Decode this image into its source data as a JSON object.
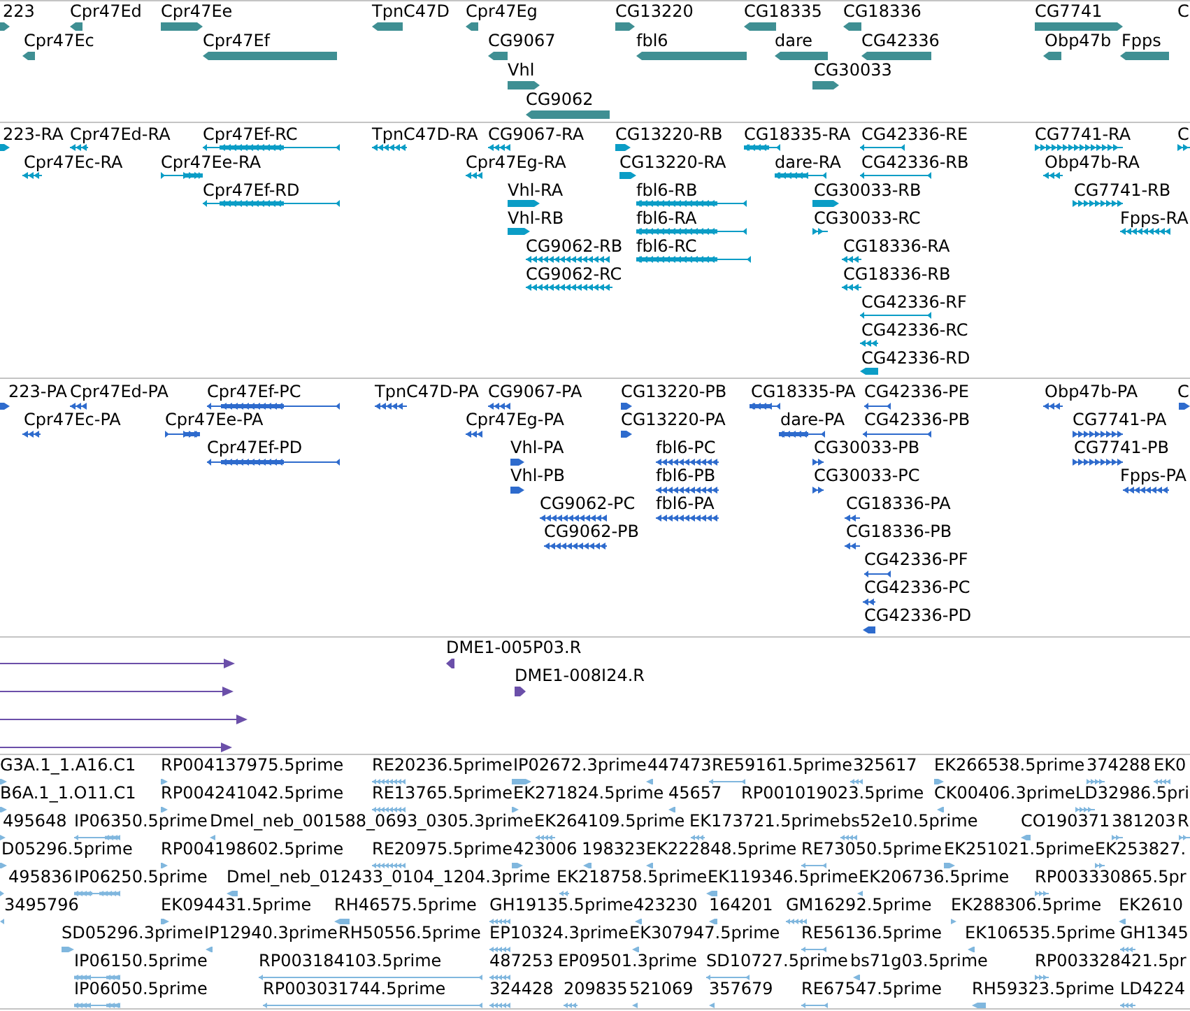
{
  "tracks": [
    {
      "kind": "gene",
      "lanes": [
        {
          "features": [
            {
              "label": "223",
              "reverse": false
            },
            {
              "label": "Cpr47Ed",
              "reverse": true
            },
            {
              "label": "Cpr47Ee",
              "reverse": false
            },
            {
              "label": "TpnC47D",
              "reverse": true
            },
            {
              "label": "Cpr47Eg",
              "reverse": true
            },
            {
              "label": "CG13220",
              "reverse": false
            },
            {
              "label": "CG18335",
              "reverse": true
            },
            {
              "label": "CG18336",
              "reverse": true
            },
            {
              "label": "CG7741",
              "reverse": false
            },
            {
              "label": "C"
            }
          ]
        },
        {
          "features": [
            {
              "label": "Cpr47Ec",
              "reverse": true
            },
            {
              "label": "Cpr47Ef",
              "reverse": true
            },
            {
              "label": "CG9067",
              "reverse": true
            },
            {
              "label": "fbl6",
              "reverse": true
            },
            {
              "label": "dare",
              "reverse": true
            },
            {
              "label": "CG42336",
              "reverse": true
            },
            {
              "label": "Obp47b",
              "reverse": true
            },
            {
              "label": "Fpps",
              "reverse": true
            }
          ]
        },
        {
          "features": [
            {
              "label": "Vhl",
              "reverse": false
            },
            {
              "label": "CG30033",
              "reverse": false
            }
          ]
        },
        {
          "features": [
            {
              "label": "CG9062",
              "reverse": true
            }
          ]
        }
      ]
    },
    {
      "kind": "transcript",
      "lanes": [
        {
          "features": [
            {
              "label": "223-RA",
              "reverse": false
            },
            {
              "label": "Cpr47Ed-RA",
              "reverse": true
            },
            {
              "label": "Cpr47Ef-RC",
              "reverse": true
            },
            {
              "label": "TpnC47D-RA",
              "reverse": true
            },
            {
              "label": "CG9067-RA",
              "reverse": true
            },
            {
              "label": "CG13220-RB",
              "reverse": false
            },
            {
              "label": "CG18335-RA",
              "reverse": true
            },
            {
              "label": "CG42336-RE",
              "reverse": true
            },
            {
              "label": "CG7741-RA",
              "reverse": false
            },
            {
              "label": "C",
              "reverse": false
            }
          ]
        },
        {
          "features": [
            {
              "label": "Cpr47Ec-RA",
              "reverse": true
            },
            {
              "label": "Cpr47Ee-RA",
              "reverse": false
            },
            {
              "label": "Cpr47Eg-RA",
              "reverse": true
            },
            {
              "label": "CG13220-RA",
              "reverse": false
            },
            {
              "label": "dare-RA",
              "reverse": true
            },
            {
              "label": "CG42336-RB",
              "reverse": true
            },
            {
              "label": "Obp47b-RA",
              "reverse": true
            }
          ]
        },
        {
          "features": [
            {
              "label": "Cpr47Ef-RD",
              "reverse": true
            },
            {
              "label": "Vhl-RA",
              "reverse": false
            },
            {
              "label": "fbl6-RB",
              "reverse": true
            },
            {
              "label": "CG30033-RB",
              "reverse": false
            },
            {
              "label": "CG7741-RB",
              "reverse": false
            }
          ]
        },
        {
          "features": [
            {
              "label": "Vhl-RB",
              "reverse": false
            },
            {
              "label": "fbl6-RA",
              "reverse": true
            },
            {
              "label": "CG30033-RC",
              "reverse": false
            },
            {
              "label": "Fpps-RA",
              "reverse": true
            }
          ]
        },
        {
          "features": [
            {
              "label": "CG9062-RB",
              "reverse": true
            },
            {
              "label": "fbl6-RC",
              "reverse": true
            },
            {
              "label": "CG18336-RA",
              "reverse": true
            }
          ]
        },
        {
          "features": [
            {
              "label": "CG9062-RC",
              "reverse": true
            },
            {
              "label": "CG18336-RB",
              "reverse": true
            }
          ]
        },
        {
          "features": [
            {
              "label": "CG42336-RF",
              "reverse": true
            }
          ]
        },
        {
          "features": [
            {
              "label": "CG42336-RC",
              "reverse": true
            }
          ]
        },
        {
          "features": [
            {
              "label": "CG42336-RD",
              "reverse": true
            }
          ]
        }
      ]
    },
    {
      "kind": "protein",
      "lanes": [
        {
          "features": [
            {
              "label": "223-PA",
              "reverse": false
            },
            {
              "label": "Cpr47Ed-PA",
              "reverse": true
            },
            {
              "label": "Cpr47Ef-PC",
              "reverse": true
            },
            {
              "label": "TpnC47D-PA",
              "reverse": true
            },
            {
              "label": "CG9067-PA",
              "reverse": true
            },
            {
              "label": "CG13220-PB",
              "reverse": false
            },
            {
              "label": "CG18335-PA",
              "reverse": true
            },
            {
              "label": "CG42336-PE",
              "reverse": true
            },
            {
              "label": "Obp47b-PA",
              "reverse": true
            },
            {
              "label": "C",
              "reverse": false
            }
          ]
        },
        {
          "features": [
            {
              "label": "Cpr47Ec-PA",
              "reverse": true
            },
            {
              "label": "Cpr47Ee-PA",
              "reverse": false
            },
            {
              "label": "Cpr47Eg-PA",
              "reverse": true
            },
            {
              "label": "CG13220-PA",
              "reverse": false
            },
            {
              "label": "dare-PA",
              "reverse": true
            },
            {
              "label": "CG42336-PB",
              "reverse": true
            },
            {
              "label": "CG7741-PA",
              "reverse": false
            }
          ]
        },
        {
          "features": [
            {
              "label": "Cpr47Ef-PD",
              "reverse": true
            },
            {
              "label": "Vhl-PA",
              "reverse": false
            },
            {
              "label": "fbl6-PC",
              "reverse": true
            },
            {
              "label": "CG30033-PB",
              "reverse": false
            },
            {
              "label": "CG7741-PB",
              "reverse": false
            }
          ]
        },
        {
          "features": [
            {
              "label": "Vhl-PB",
              "reverse": false
            },
            {
              "label": "fbl6-PB",
              "reverse": true
            },
            {
              "label": "CG30033-PC",
              "reverse": false
            },
            {
              "label": "Fpps-PA",
              "reverse": true
            }
          ]
        },
        {
          "features": [
            {
              "label": "CG9062-PC",
              "reverse": true
            },
            {
              "label": "fbl6-PA",
              "reverse": true
            },
            {
              "label": "CG18336-PA",
              "reverse": true
            }
          ]
        },
        {
          "features": [
            {
              "label": "CG9062-PB",
              "reverse": true
            },
            {
              "label": "CG18336-PB",
              "reverse": true
            }
          ]
        },
        {
          "features": [
            {
              "label": "CG42336-PF",
              "reverse": true
            }
          ]
        },
        {
          "features": [
            {
              "label": "CG42336-PC",
              "reverse": true
            }
          ]
        },
        {
          "features": [
            {
              "label": "CG42336-PD",
              "reverse": true
            }
          ]
        }
      ]
    },
    {
      "kind": "clone",
      "lanes": [
        {
          "features": [
            {
              "reverse": false
            },
            {
              "label": "DME1-005P03.R",
              "reverse": true
            }
          ]
        },
        {
          "features": [
            {
              "reverse": false
            },
            {
              "label": "DME1-008I24.R",
              "reverse": false
            }
          ]
        },
        {
          "features": [
            {
              "reverse": false
            }
          ]
        },
        {
          "features": [
            {
              "reverse": false
            }
          ]
        }
      ]
    },
    {
      "kind": "est",
      "lanes": [
        {
          "features": [
            {
              "label": "G3A.1_1.A16.C1",
              "reverse": false
            },
            {
              "label": "RP004137975.5prime",
              "reverse": false
            },
            {
              "label": "RE20236.5prime",
              "reverse": true
            },
            {
              "label": "IP02672.3prime",
              "reverse": false
            },
            {
              "label": "447473",
              "reverse": true
            },
            {
              "label": "RE59161.5prime",
              "reverse": true
            },
            {
              "label": "325617",
              "reverse": true
            },
            {
              "label": "EK266538.5prime",
              "reverse": false
            },
            {
              "label": "374288",
              "reverse": false
            },
            {
              "label": "EK0",
              "reverse": true
            }
          ]
        },
        {
          "features": [
            {
              "label": "B6A.1_1.O11.C1",
              "reverse": false
            },
            {
              "label": "RP004241042.5prime",
              "reverse": false
            },
            {
              "label": "RE13765.5prime",
              "reverse": true
            },
            {
              "label": "EK271824.5prime",
              "reverse": false
            },
            {
              "label": "45657",
              "reverse": true
            },
            {
              "label": "RP001019023.5prime"
            },
            {
              "label": "CK00406.3prime",
              "reverse": true
            },
            {
              "label": "LD32986.5pri",
              "reverse": false
            }
          ]
        },
        {
          "features": [
            {
              "label": "495648",
              "reverse": false
            },
            {
              "label": "IP06350.5prime",
              "reverse": true
            },
            {
              "label": "Dmel_neb_001588_0693_0305.3prime",
              "reverse": true
            },
            {
              "label": "EK264109.5prime",
              "reverse": true
            },
            {
              "label": "EK173721.5prime",
              "reverse": true
            },
            {
              "label": "bs52e10.5prime",
              "reverse": true
            },
            {
              "label": "CO190371",
              "reverse": true
            },
            {
              "label": "381203",
              "reverse": false
            },
            {
              "label": "R",
              "reverse": false
            }
          ]
        },
        {
          "features": [
            {
              "label": "D05296.5prime",
              "reverse": false
            },
            {
              "label": "RP004198602.5prime",
              "reverse": false
            },
            {
              "label": "RE20975.5prime",
              "reverse": true
            },
            {
              "label": "423006",
              "reverse": false
            },
            {
              "label": "198323",
              "reverse": true
            },
            {
              "label": "EK222848.5prime",
              "reverse": true
            },
            {
              "label": "RE73050.5prime",
              "reverse": true
            },
            {
              "label": "EK251021.5prime",
              "reverse": false
            },
            {
              "label": "EK253827.",
              "reverse": false
            }
          ]
        },
        {
          "features": [
            {
              "label": "495836",
              "reverse": false
            },
            {
              "label": "IP06250.5prime",
              "reverse": true
            },
            {
              "label": "Dmel_neb_012433_0104_1204.3prime",
              "reverse": true
            },
            {
              "label": "EK218758.5prime",
              "reverse": true
            },
            {
              "label": "EK119346.5prime",
              "reverse": true
            },
            {
              "label": "EK206736.5prime",
              "reverse": true
            },
            {
              "label": "RP003330865.5pr",
              "reverse": false
            }
          ]
        },
        {
          "features": [
            {
              "label": "3495796",
              "reverse": true
            },
            {
              "label": "EK094431.5prime",
              "reverse": false
            },
            {
              "label": "RH46575.5prime",
              "reverse": true
            },
            {
              "label": "GH19135.5prime",
              "reverse": true
            },
            {
              "label": "423230",
              "reverse": true
            },
            {
              "label": "164201",
              "reverse": true
            },
            {
              "label": "GM16292.5prime",
              "reverse": true
            },
            {
              "label": "EK288306.5prime",
              "reverse": false
            },
            {
              "label": "EK2610",
              "reverse": true
            }
          ]
        },
        {
          "features": [
            {
              "label": "SD05296.3prime",
              "reverse": false
            },
            {
              "label": "IP12940.3prime",
              "reverse": true
            },
            {
              "label": "RH50556.5prime"
            },
            {
              "label": "EP10324.3prime",
              "reverse": true
            },
            {
              "label": "EK307947.5prime",
              "reverse": true
            },
            {
              "label": "RE56136.5prime",
              "reverse": true
            },
            {
              "label": "EK106535.5prime",
              "reverse": true
            },
            {
              "label": "GH1345",
              "reverse": true
            }
          ]
        },
        {
          "features": [
            {
              "label": "IP06150.5prime",
              "reverse": true
            },
            {
              "label": "RP003184103.5prime",
              "reverse": true
            },
            {
              "label": "487253",
              "reverse": true
            },
            {
              "label": "EP09501.3prime"
            },
            {
              "label": "SD10727.5prime",
              "reverse": true
            },
            {
              "label": "bs71g03.5prime",
              "reverse": true
            },
            {
              "label": "RP003328421.5pr",
              "reverse": false
            }
          ]
        },
        {
          "features": [
            {
              "label": "IP06050.5prime",
              "reverse": true
            },
            {
              "label": "RP003031744.5prime",
              "reverse": true
            },
            {
              "label": "324428",
              "reverse": true
            },
            {
              "label": "209835",
              "reverse": true
            },
            {
              "label": "521069",
              "reverse": true
            },
            {
              "label": "357679",
              "reverse": true
            },
            {
              "label": "RE67547.5prime",
              "reverse": true
            },
            {
              "label": "RH59323.5prime",
              "reverse": true
            },
            {
              "label": "LD4224",
              "reverse": true
            }
          ]
        }
      ]
    }
  ]
}
